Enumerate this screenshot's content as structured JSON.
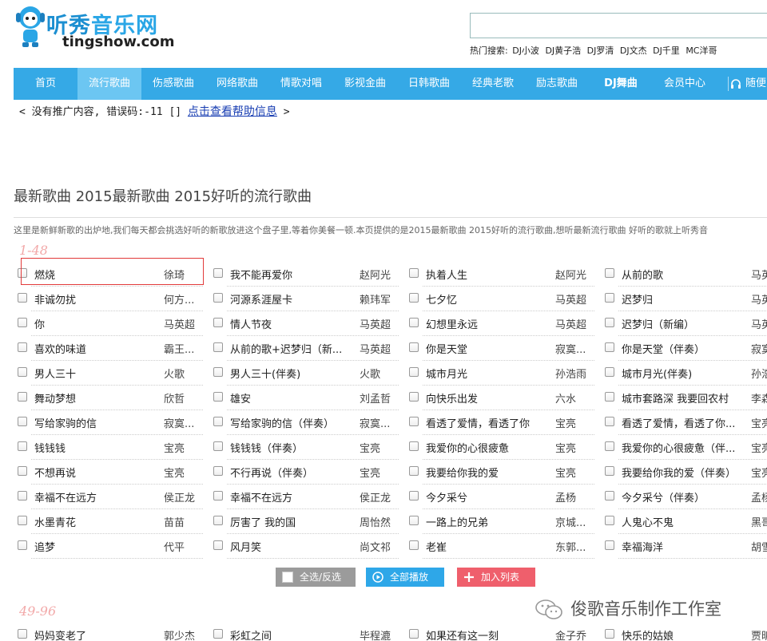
{
  "site": {
    "name_cn_1": "听秀",
    "name_cn_2": "音乐网",
    "name_en": "tingshow.com"
  },
  "search": {
    "placeholder": ""
  },
  "hot_search": {
    "label": "热门搜索:",
    "items": [
      "DJ小波",
      "DJ黄子浩",
      "DJ罗清",
      "DJ文杰",
      "DJ千里",
      "MC洋哥"
    ]
  },
  "nav": [
    "首页",
    "流行歌曲",
    "伤感歌曲",
    "网络歌曲",
    "情歌对唱",
    "影视金曲",
    "日韩歌曲",
    "经典老歌",
    "励志歌曲",
    "DJ舞曲",
    "会员中心",
    "随便"
  ],
  "nav_active": 1,
  "promo": {
    "text": "< 没有推广内容, 错误码:-11 [] ",
    "link": "点击查看帮助信息",
    "end": " >"
  },
  "title": "最新歌曲 2015最新歌曲 2015好听的流行歌曲",
  "description": "这里是新鲜新歌的出炉地,我们每天都会挑选好听的新歌放进这个盘子里,等着你美餐一顿.本页提供的是2015最新歌曲 2015好听的流行歌曲,想听最新流行歌曲 好听的歌就上听秀音",
  "section1": {
    "range": "1-48",
    "rows": [
      [
        [
          "燃烧",
          "徐琦"
        ],
        [
          "我不能再爱你",
          "赵阿光"
        ],
        [
          "执着人生",
          "赵阿光"
        ],
        [
          "从前的歌",
          "马英"
        ]
      ],
      [
        [
          "非诚勿扰",
          "何方..."
        ],
        [
          "河源系涯屋卡",
          "赖玮军"
        ],
        [
          "七夕忆",
          "马英超"
        ],
        [
          "迟梦归",
          "马英"
        ]
      ],
      [
        [
          "你",
          "马英超"
        ],
        [
          "情人节夜",
          "马英超"
        ],
        [
          "幻想里永远",
          "马英超"
        ],
        [
          "迟梦归（新编）",
          "马英"
        ]
      ],
      [
        [
          "喜欢的味道",
          "霸王..."
        ],
        [
          "从前的歌+迟梦归（新...",
          "马英超"
        ],
        [
          "你是天堂",
          "寂寞..."
        ],
        [
          "你是天堂（伴奏）",
          "寂寞"
        ]
      ],
      [
        [
          "男人三十",
          "火歌"
        ],
        [
          "男人三十(伴奏)",
          "火歌"
        ],
        [
          "城市月光",
          "孙浩雨"
        ],
        [
          "城市月光(伴奏)",
          "孙浩"
        ]
      ],
      [
        [
          "舞动梦想",
          "欣哲"
        ],
        [
          "雄安",
          "刘孟哲"
        ],
        [
          "向快乐出发",
          "六水"
        ],
        [
          "城市套路深 我要回农村",
          "李森"
        ]
      ],
      [
        [
          "写给家驹的信",
          "寂寞..."
        ],
        [
          "写给家驹的信（伴奏）",
          "寂寞..."
        ],
        [
          "看透了爱情，看透了你",
          "宝亮"
        ],
        [
          "看透了爱情，看透了你...",
          "宝亮"
        ]
      ],
      [
        [
          "钱钱钱",
          "宝亮"
        ],
        [
          "钱钱钱（伴奏）",
          "宝亮"
        ],
        [
          "我爱你的心很疲惫",
          "宝亮"
        ],
        [
          "我爱你的心很疲惫（伴...",
          "宝亮"
        ]
      ],
      [
        [
          "不想再说",
          "宝亮"
        ],
        [
          "不行再说（伴奏）",
          "宝亮"
        ],
        [
          "我要给你我的爱",
          "宝亮"
        ],
        [
          "我要给你我的爱（伴奏）",
          "宝亮"
        ]
      ],
      [
        [
          "幸福不在远方",
          "侯正龙"
        ],
        [
          "幸福不在远方",
          "侯正龙"
        ],
        [
          "今夕采兮",
          "孟杨"
        ],
        [
          "今夕采兮（伴奏）",
          "孟杨"
        ]
      ],
      [
        [
          "水墨青花",
          "苗苗"
        ],
        [
          "厉害了 我的国",
          "周怡然"
        ],
        [
          "一路上的兄弟",
          "京城..."
        ],
        [
          "人鬼心不鬼",
          "黑哥"
        ]
      ],
      [
        [
          "追梦",
          "代平"
        ],
        [
          "风月笑",
          "尚文祁"
        ],
        [
          "老崔",
          "东郭..."
        ],
        [
          "幸福海洋",
          "胡雪"
        ]
      ]
    ]
  },
  "buttons": {
    "select": "全选/反选",
    "play": "全部播放",
    "add": "加入列表"
  },
  "section2": {
    "range": "49-96",
    "rows": [
      [
        [
          "妈妈变老了",
          "郭少杰"
        ],
        [
          "彩虹之间",
          "毕程漉"
        ],
        [
          "如果还有这一刻",
          "金子乔"
        ],
        [
          "快乐的姑娘",
          "贾昕"
        ]
      ]
    ]
  },
  "watermark": "俊歌音乐制作工作室"
}
